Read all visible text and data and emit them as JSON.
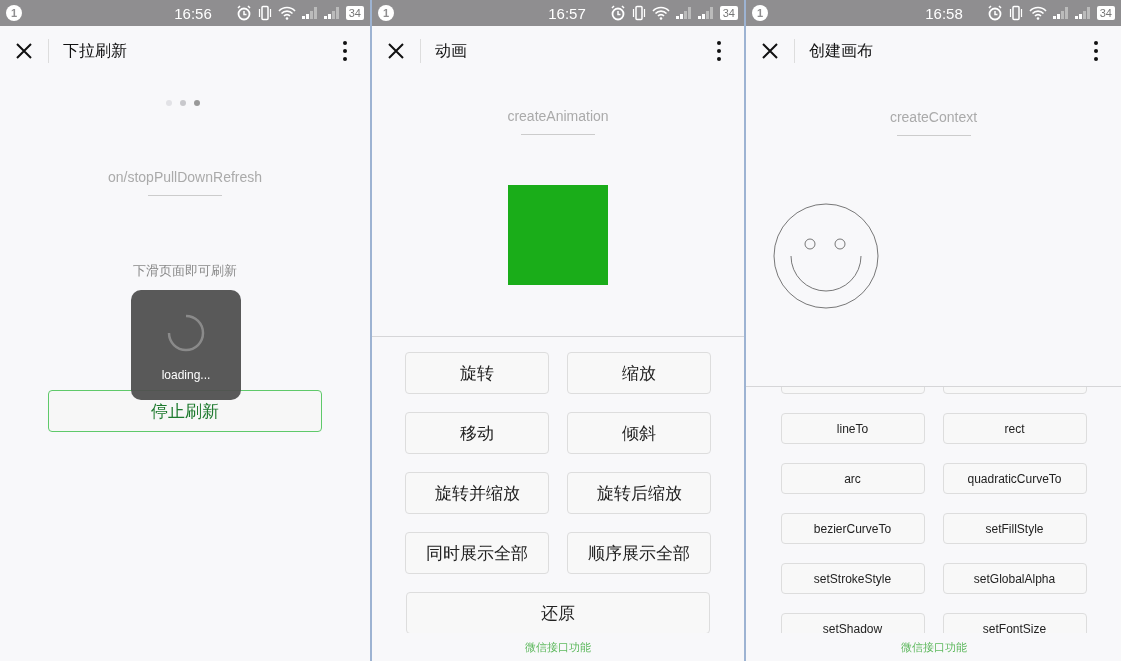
{
  "screens": [
    {
      "kind": "refresh",
      "status_bar": {
        "notification": "1",
        "time": "16:56",
        "battery": "34"
      },
      "title": "下拉刷新",
      "caption": "on/stopPullDownRefresh",
      "hint": "下滑页面即可刷新",
      "button": "停止刷新",
      "toast": "loading..."
    },
    {
      "kind": "animation",
      "status_bar": {
        "notification": "1",
        "time": "16:57",
        "battery": "34"
      },
      "title": "动画",
      "caption": "createAnimation",
      "buttons": [
        "旋转",
        "缩放",
        "移动",
        "倾斜",
        "旋转并缩放",
        "旋转后缩放",
        "同时展示全部",
        "顺序展示全部"
      ],
      "wide_button": "还原",
      "footer": "微信接口功能"
    },
    {
      "kind": "canvas",
      "status_bar": {
        "notification": "1",
        "time": "16:58",
        "battery": "34"
      },
      "title": "创建画布",
      "caption": "createContext",
      "buttons": [
        "lineTo",
        "rect",
        "arc",
        "quadraticCurveTo",
        "bezierCurveTo",
        "setFillStyle",
        "setStrokeStyle",
        "setGlobalAlpha",
        "setShadow",
        "setFontSize"
      ],
      "footer": "微信接口功能"
    }
  ]
}
